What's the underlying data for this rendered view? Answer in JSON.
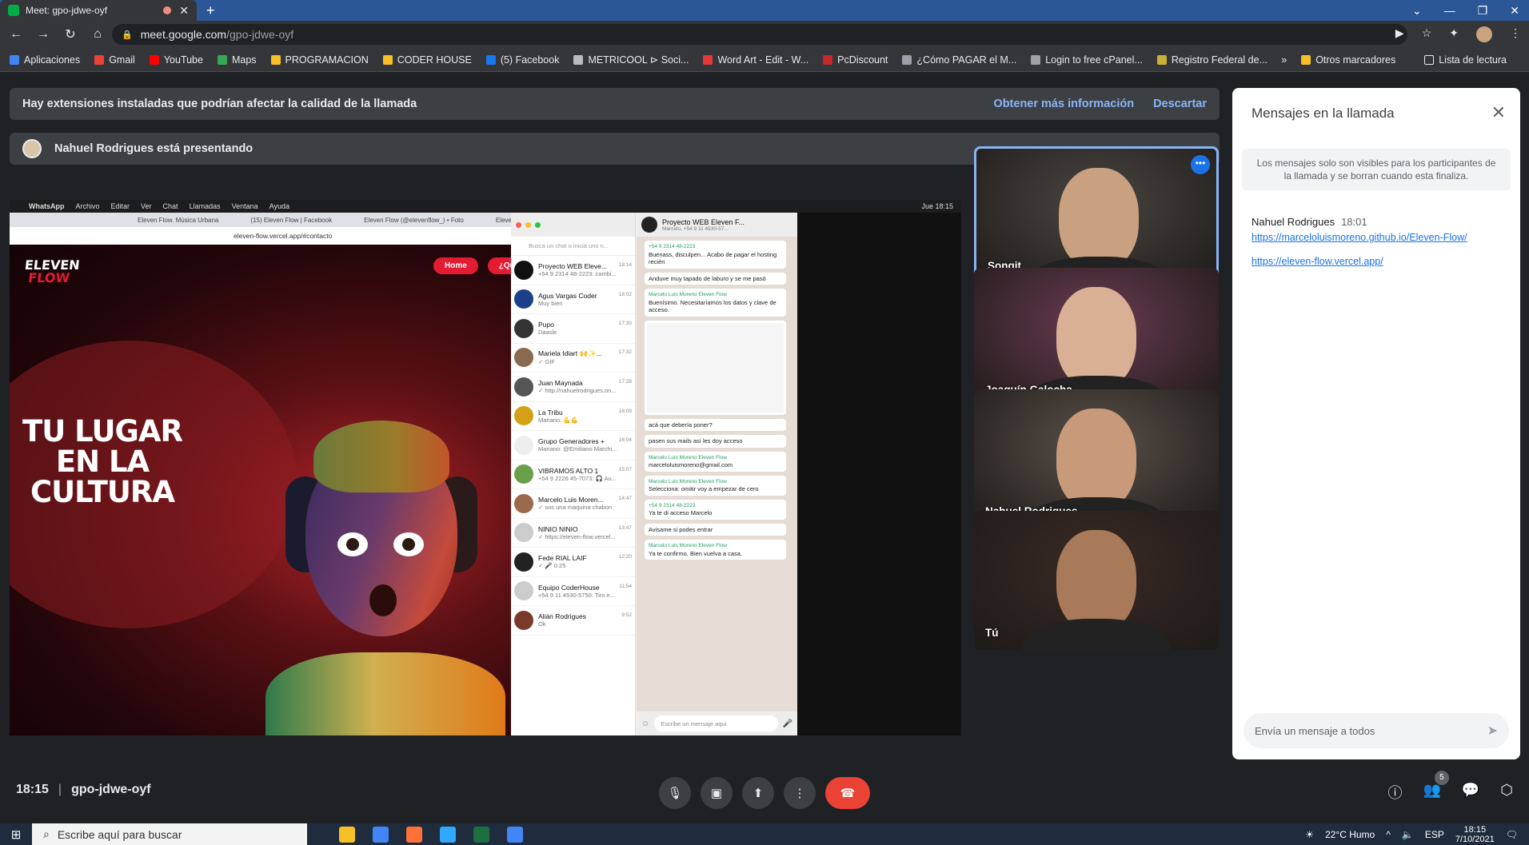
{
  "browser": {
    "tab_title": "Meet: gpo-jdwe-oyf",
    "url_host": "meet.google.com",
    "url_path": "/gpo-jdwe-oyf",
    "bookmarks": [
      "Aplicaciones",
      "Gmail",
      "YouTube",
      "Maps",
      "PROGRAMACION",
      "CODER HOUSE",
      "(5) Facebook",
      "METRICOOL ⊳ Soci...",
      "Word Art - Edit - W...",
      "PcDiscount",
      "¿Cómo PAGAR el M...",
      "Login to free cPanel...",
      "Registro Federal de..."
    ],
    "bookmark_colors": [
      "#4285f4",
      "#ea4335",
      "#ff0000",
      "#34a853",
      "#f6c026",
      "#f6c026",
      "#1877f2",
      "#bbbbbb",
      "#e53935",
      "#c62828",
      "#9aa0a6",
      "#9aa0a6",
      "#c9b037"
    ],
    "other_bookmarks": "Otros marcadores",
    "reading_list": "Lista de lectura",
    "more_chevron": "»"
  },
  "banner": {
    "text": "Hay extensiones instaladas que podrían afectar la calidad de la llamada",
    "more_info": "Obtener más información",
    "dismiss": "Descartar"
  },
  "presenting": {
    "text": "Nahuel Rodrigues está presentando"
  },
  "shared_screen": {
    "mac_menu": [
      "WhatsApp",
      "Archivo",
      "Editar",
      "Ver",
      "Chat",
      "Llamadas",
      "Ventana",
      "Ayuda"
    ],
    "mac_clock": "Jue 18:15",
    "browser_tabs": [
      "Eleven Flow. Música Urbana",
      "(15) Eleven Flow | Facebook",
      "Eleven Flow (@elevenflow_) • Foto",
      "Eleven Flow (@elevenflow_) • Foto"
    ],
    "browser_url": "eleven-flow.vercel.app/#contacto",
    "site_logo_top": "ELEVEN",
    "site_logo_bottom": "FLOW",
    "site_nav": [
      "Home",
      "¿Quiénes somos?"
    ],
    "hero_lines": [
      "TU LUGAR",
      "EN LA",
      "CULTURA"
    ],
    "whatsapp": {
      "search_placeholder": "Busca un chat o inicia uno n...",
      "chats": [
        {
          "name": "Proyecto WEB Eleve...",
          "time": "18:14",
          "msg": "+54 9 2314 48-2223: cambi...",
          "color": "#111"
        },
        {
          "name": "Agus Vargas Coder",
          "time": "18:02",
          "msg": "Muy bien",
          "color": "#1c3f8a"
        },
        {
          "name": "Pupo",
          "time": "17:30",
          "msg": "Daasle",
          "color": "#333"
        },
        {
          "name": "Mariela Idiart 🙌✨...",
          "time": "17:32",
          "msg": "✓ GIF",
          "color": "#8a6a50"
        },
        {
          "name": "Juan Maynada",
          "time": "17:28",
          "msg": "✓ http://nahuelrodrigues.on...",
          "color": "#555"
        },
        {
          "name": "La Tribu",
          "time": "16:09",
          "msg": "Mariano: 💪💪",
          "color": "#d4a017"
        },
        {
          "name": "Grupo Generadores +",
          "time": "16:04",
          "msg": "Mariano: @Emiliano Marchi...",
          "color": "#eee"
        },
        {
          "name": "VIBRAMOS ALTO 1",
          "time": "15:07",
          "msg": "+54 9 2226 45-7073: 🎧 Au...",
          "color": "#6aa04a"
        },
        {
          "name": "Marcelo Luis Moren...",
          "time": "14:47",
          "msg": "✓ sos una maquina chabon",
          "color": "#9a6a4a"
        },
        {
          "name": "NINIO NINIO",
          "time": "13:47",
          "msg": "✓ https://eleven-flow.vercel...",
          "color": "#ccc"
        },
        {
          "name": "Fede RIAL LAIF",
          "time": "12:20",
          "msg": "✓ 🎤 0:25",
          "color": "#222"
        },
        {
          "name": "Equipo CoderHouse",
          "time": "11:54",
          "msg": "+54 9 11 4530-5750: Tiro e...",
          "color": "#ccc"
        },
        {
          "name": "Alián Rodrigues",
          "time": "9:52",
          "msg": "Ok",
          "color": "#7a3a2a"
        }
      ],
      "group_name": "Proyecto WEB Eleven F...",
      "group_sub": "Marcelo, +54 9 11 4530-57...",
      "messages": [
        {
          "author": "+54 9 2314 48-2223",
          "text": "Buenass, disculpen... Acabo de pagar el hosting recién"
        },
        {
          "author": "",
          "text": "Anduve muy tapado de laburo y se me pasó"
        },
        {
          "author": "Marcelo Luis Moreno Eleven Flow",
          "text": "Buenísimo. Necesitaríamos los datos y clave de acceso."
        },
        {
          "author": "",
          "text": "acá que debería poner?"
        },
        {
          "author": "",
          "text": "pasen sus mails así les doy acceso"
        },
        {
          "author": "Marcelo Luis Moreno Eleven Flow",
          "text": "marceloluismoreno@gmail.com"
        },
        {
          "author": "Marcelo Luis Moreno Eleven Flow",
          "text": "Selecciona: omitir voy a empezar de cero"
        },
        {
          "author": "+54 9 2314 48-2223",
          "text": "Ya te di acceso Marcelo"
        },
        {
          "author": "",
          "text": "Avisame si podes entrar"
        },
        {
          "author": "Marcelo Luis Moreno Eleven Flow",
          "text": "Ya te confirmo. Bien vuelva a casa."
        }
      ],
      "compose_placeholder": "Escribe un mensaje aquí"
    }
  },
  "participants": [
    {
      "name": "Songit",
      "bg": "#4a4642",
      "face": "#c9a080"
    },
    {
      "name": "Joaquín Galocha",
      "bg": "#6a3b52",
      "face": "#d9b094"
    },
    {
      "name": "Nahuel Rodrigues",
      "bg": "#5a5048",
      "face": "#c89a7a"
    },
    {
      "name": "Tú",
      "bg": "#3a2a24",
      "face": "#a87a5a"
    }
  ],
  "chat_panel": {
    "title": "Mensajes en la llamada",
    "note": "Los mensajes solo son visibles para los participantes de la llamada y se borran cuando esta finaliza.",
    "sender": "Nahuel Rodrigues",
    "time": "18:01",
    "links": [
      "https://marceloluismoreno.github.io/Eleven-Flow/",
      "https://eleven-flow.vercel.app/"
    ],
    "input_placeholder": "Envía un mensaje a todos"
  },
  "bottom_bar": {
    "time": "18:15",
    "meeting_code": "gpo-jdwe-oyf",
    "participants_count": "5"
  },
  "taskbar": {
    "search_placeholder": "Escribe aquí para buscar",
    "weather": "22°C Humo",
    "lang": "ESP",
    "clock_time": "18:15",
    "clock_date": "7/10/2021",
    "app_colors": [
      "#f6c026",
      "#4285f4",
      "#ff7139",
      "#31a8ff",
      "#1d6f42",
      "#4285f4"
    ]
  }
}
